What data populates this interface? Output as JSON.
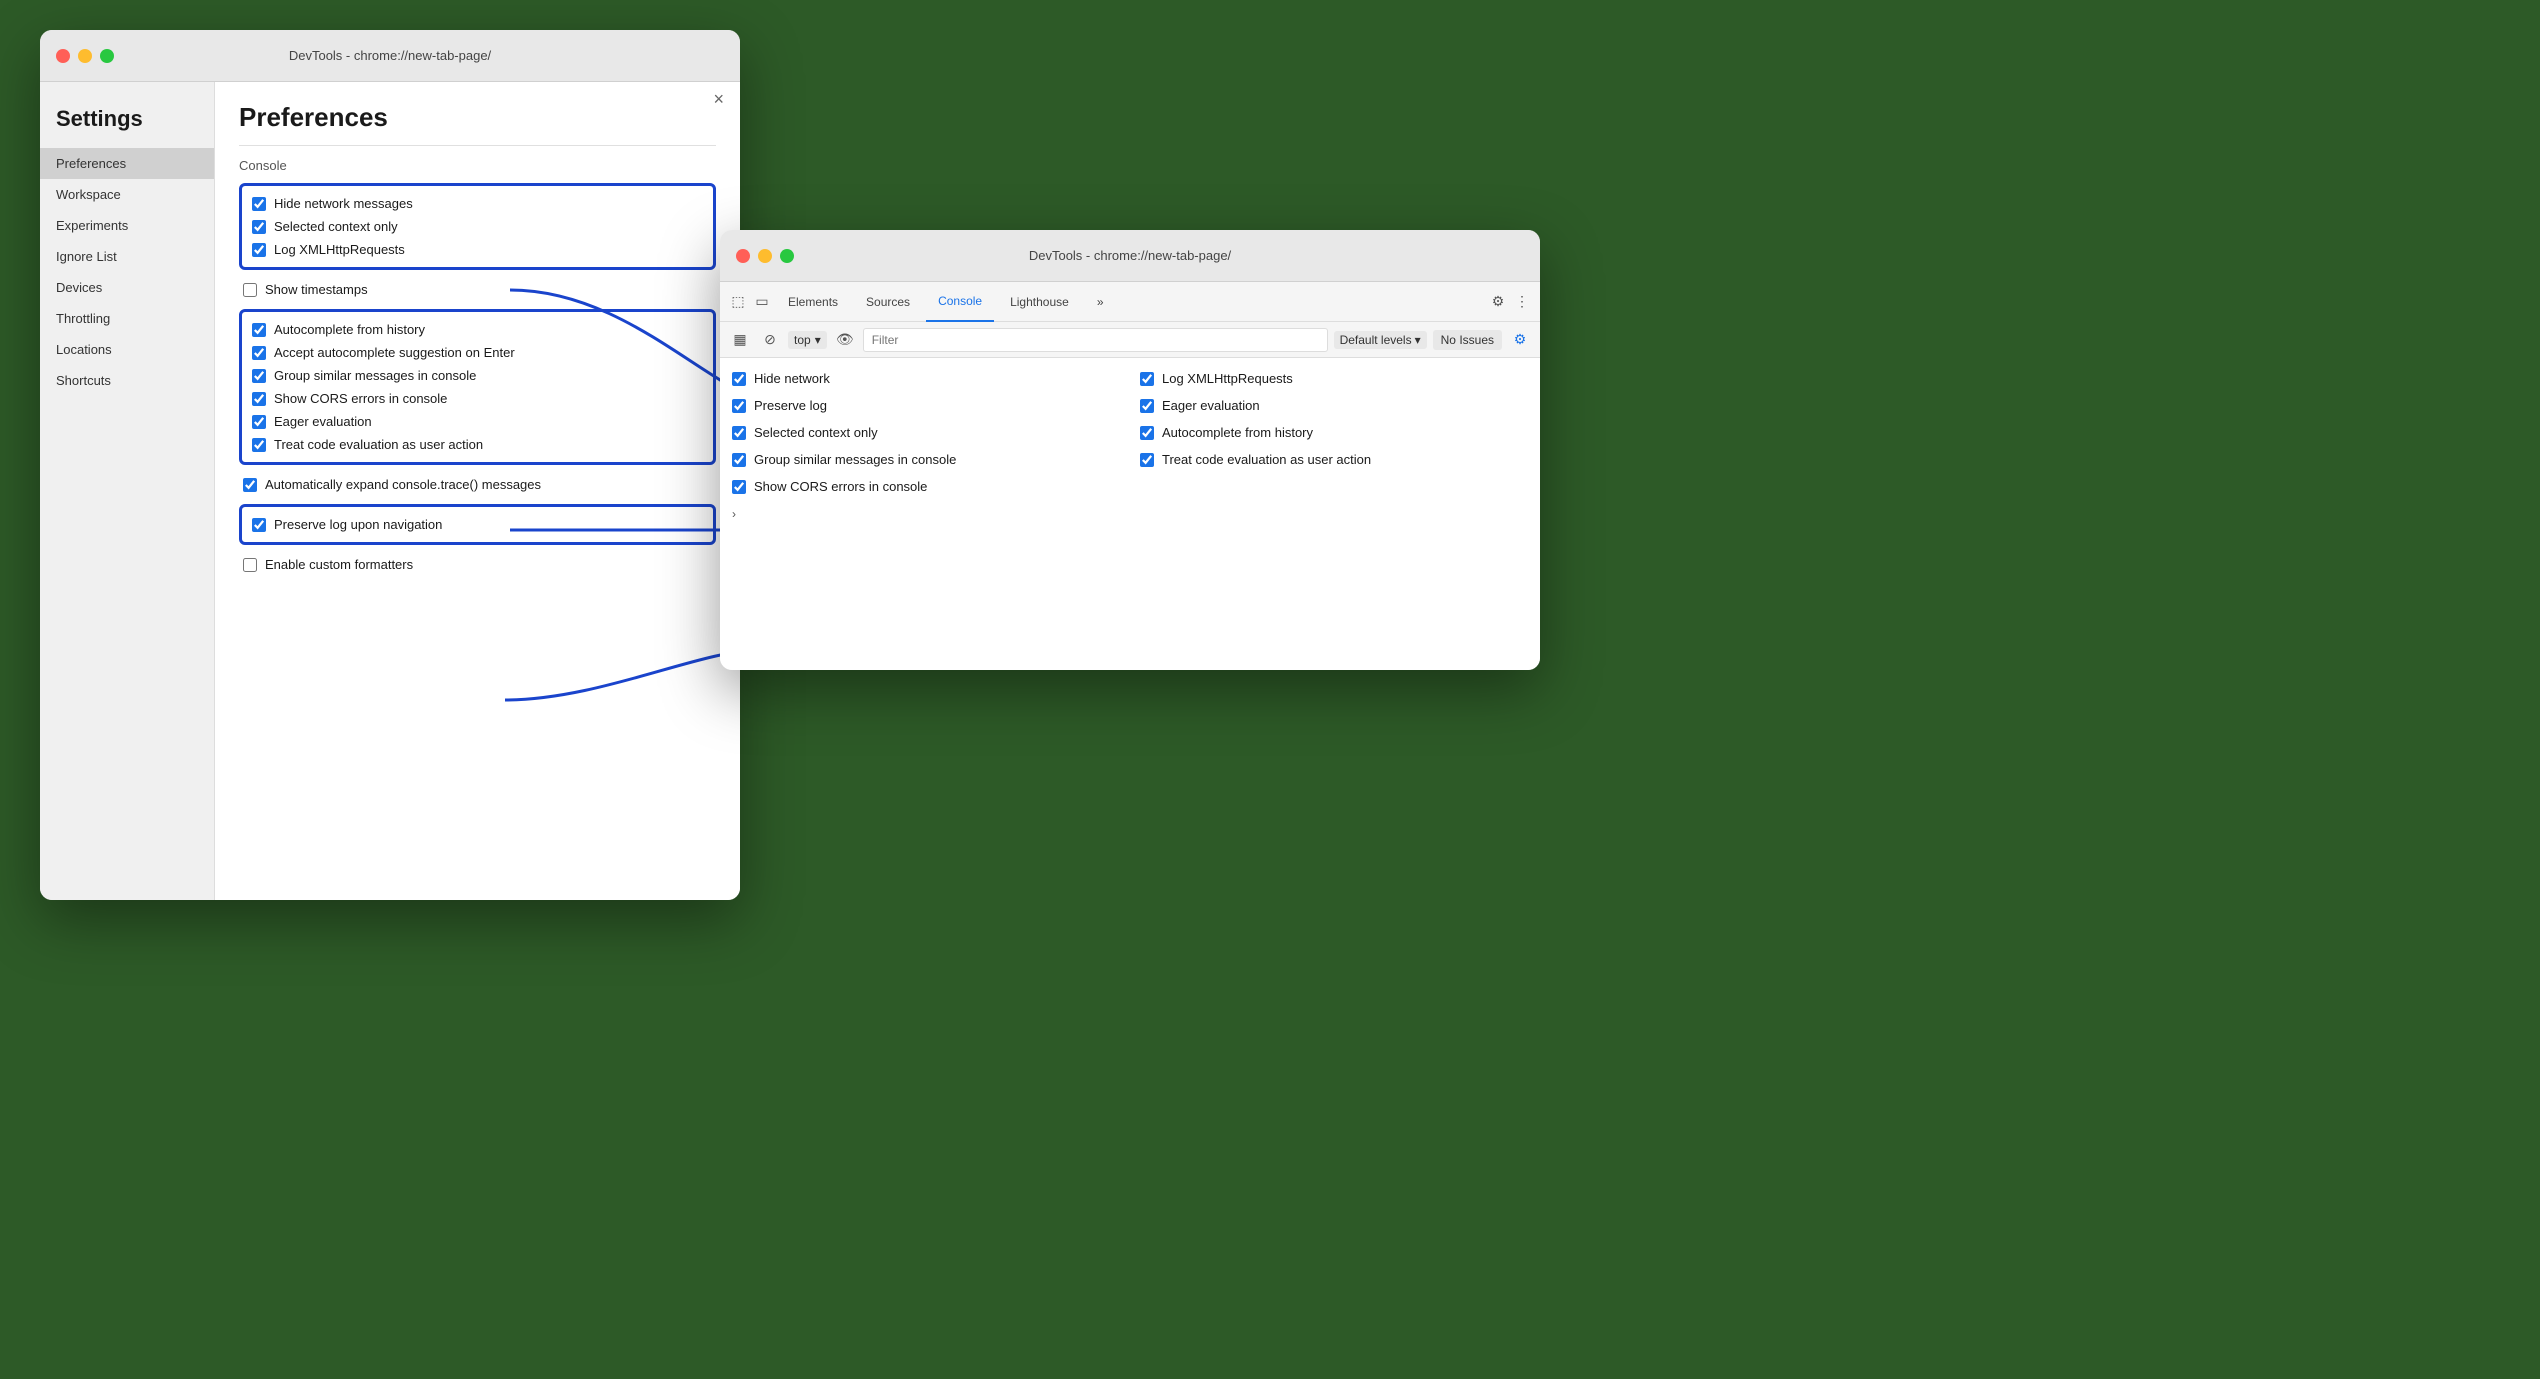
{
  "leftWindow": {
    "titlebar": "DevTools - chrome://new-tab-page/",
    "sidebar": {
      "title": "Settings",
      "items": [
        {
          "label": "Preferences",
          "active": true
        },
        {
          "label": "Workspace",
          "active": false
        },
        {
          "label": "Experiments",
          "active": false
        },
        {
          "label": "Ignore List",
          "active": false
        },
        {
          "label": "Devices",
          "active": false
        },
        {
          "label": "Throttling",
          "active": false
        },
        {
          "label": "Locations",
          "active": false
        },
        {
          "label": "Shortcuts",
          "active": false
        }
      ]
    },
    "preferences": {
      "title": "Preferences",
      "sectionLabel": "Console",
      "closeBtn": "×",
      "group1": [
        {
          "label": "Hide network messages",
          "checked": true
        },
        {
          "label": "Selected context only",
          "checked": true
        },
        {
          "label": "Log XMLHttpRequests",
          "checked": true
        }
      ],
      "standalone": [
        {
          "label": "Show timestamps",
          "checked": false
        }
      ],
      "group2": [
        {
          "label": "Autocomplete from history",
          "checked": true
        },
        {
          "label": "Accept autocomplete suggestion on Enter",
          "checked": true
        },
        {
          "label": "Group similar messages in console",
          "checked": true
        },
        {
          "label": "Show CORS errors in console",
          "checked": true
        },
        {
          "label": "Eager evaluation",
          "checked": true
        },
        {
          "label": "Treat code evaluation as user action",
          "checked": true
        }
      ],
      "afterGroup2": [
        {
          "label": "Automatically expand console.trace() messages",
          "checked": true
        }
      ],
      "group3": [
        {
          "label": "Preserve log upon navigation",
          "checked": true
        }
      ],
      "afterGroup3": [
        {
          "label": "Enable custom formatters",
          "checked": false
        }
      ]
    }
  },
  "rightWindow": {
    "titlebar": "DevTools - chrome://new-tab-page/",
    "tabs": [
      {
        "label": "Elements",
        "active": false
      },
      {
        "label": "Sources",
        "active": false
      },
      {
        "label": "Console",
        "active": true
      },
      {
        "label": "Lighthouse",
        "active": false
      },
      {
        "label": "»",
        "active": false
      }
    ],
    "consoleToolbar": {
      "topLabel": "top",
      "filterPlaceholder": "Filter",
      "levelsLabel": "Default levels",
      "noIssuesLabel": "No Issues"
    },
    "consoleItems": [
      {
        "label": "Hide network",
        "checked": true,
        "col": 1
      },
      {
        "label": "Log XMLHttpRequests",
        "checked": true,
        "col": 2
      },
      {
        "label": "Preserve log",
        "checked": true,
        "col": 1
      },
      {
        "label": "Eager evaluation",
        "checked": true,
        "col": 2
      },
      {
        "label": "Selected context only",
        "checked": true,
        "col": 1
      },
      {
        "label": "Autocomplete from history",
        "checked": true,
        "col": 2
      },
      {
        "label": "Group similar messages in console",
        "checked": true,
        "col": 1
      },
      {
        "label": "Treat code evaluation as user action",
        "checked": true,
        "col": 2
      },
      {
        "label": "Show CORS errors in console",
        "checked": true,
        "col": 1
      }
    ]
  },
  "arrows": {
    "color": "#1a44cc"
  }
}
